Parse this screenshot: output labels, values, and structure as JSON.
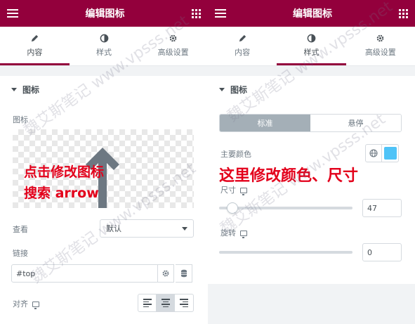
{
  "left": {
    "title": "编辑图标",
    "tabs": [
      {
        "label": "内容",
        "icon": "pencil-icon",
        "active": true
      },
      {
        "label": "样式",
        "icon": "contrast-icon",
        "active": false
      },
      {
        "label": "高级设置",
        "icon": "gear-icon",
        "active": false
      }
    ],
    "section_title": "图标",
    "icon_label": "图标",
    "annotation_line1": "点击修改图标",
    "annotation_line2": "搜索 arrow",
    "view_label": "查看",
    "view_value": "默认",
    "link_label": "链接",
    "link_value": "#top",
    "align_label": "对齐"
  },
  "right": {
    "title": "编辑图标",
    "tabs": [
      {
        "label": "内容",
        "icon": "pencil-icon",
        "active": false
      },
      {
        "label": "样式",
        "icon": "contrast-icon",
        "active": true
      },
      {
        "label": "高级设置",
        "icon": "gear-icon",
        "active": false
      }
    ],
    "section_title": "图标",
    "state_normal": "标准",
    "state_hover": "悬停",
    "primary_color_label": "主要颜色",
    "primary_color": "#4fc3f7",
    "annotation": "这里修改颜色、尺寸",
    "size_label": "尺寸",
    "size_value": "47",
    "size_fraction": 0.1,
    "rotate_label": "旋转",
    "rotate_value": "0",
    "rotate_fraction": 0.0
  },
  "watermark": "魏艾斯笔记 www.vpsss.net",
  "colors": {
    "brand": "#93003c",
    "accent_red": "#e3001b"
  }
}
